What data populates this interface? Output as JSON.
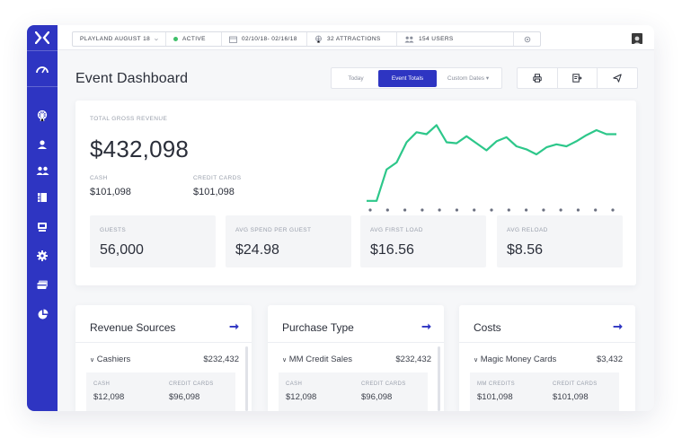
{
  "topbar": {
    "event": "PLAYLAND AUGUST 18",
    "status": "ACTIVE",
    "dates": "02/10/18- 02/16/18",
    "attractions": "32 ATTRACTIONS",
    "users": "154 USERS"
  },
  "colors": {
    "brand": "#2e35c2",
    "chart_line": "#2dc78a",
    "status_active": "#3fbf6a"
  },
  "page": {
    "title": "Event Dashboard",
    "tabs": [
      "Today",
      "Event Totals",
      "Custom Dates ▾"
    ],
    "active_tab": "Event Totals"
  },
  "summary": {
    "gross_label": "TOTAL GROSS REVENUE",
    "gross_value": "$432,098",
    "cash_label": "CASH",
    "cash_value": "$101,098",
    "credit_label": "CREDIT CARDS",
    "credit_value": "$101,098",
    "stats": [
      {
        "label": "GUESTS",
        "value": "56,000"
      },
      {
        "label": "AVG SPEND PER GUEST",
        "value": "$24.98"
      },
      {
        "label": "AVG FIRST LOAD",
        "value": "$16.56"
      },
      {
        "label": "AVG RELOAD",
        "value": "$8.56"
      }
    ]
  },
  "chart_data": {
    "type": "line",
    "title": "",
    "xlabel": "",
    "ylabel": "",
    "x": [
      1,
      2,
      3,
      4,
      5,
      6,
      7,
      8,
      9,
      10,
      11,
      12,
      13,
      14,
      15,
      16,
      17,
      18,
      19,
      20,
      21,
      22,
      23,
      24
    ],
    "series": [
      {
        "values": [
          2,
          2,
          33,
          40,
          60,
          70,
          68,
          77,
          60,
          59,
          66,
          59,
          52,
          61,
          65,
          56,
          53,
          48,
          55,
          58,
          56,
          61,
          67,
          72,
          68,
          68
        ]
      }
    ],
    "ylim": [
      0,
      80
    ],
    "grid": false,
    "dots_on_baseline": 15
  },
  "cards": [
    {
      "title": "Revenue Sources",
      "row_name": "Cashiers",
      "row_value": "$232,432",
      "sub1_label": "CASH",
      "sub1_value": "$12,098",
      "sub2_label": "CREDIT CARDS",
      "sub2_value": "$96,098"
    },
    {
      "title": "Purchase Type",
      "row_name": "MM Credit Sales",
      "row_value": "$232,432",
      "sub1_label": "CASH",
      "sub1_value": "$12,098",
      "sub2_label": "CREDIT CARDS",
      "sub2_value": "$96,098"
    },
    {
      "title": "Costs",
      "row_name": "Magic Money Cards",
      "row_value": "$3,432",
      "sub1_label": "MM CREDITS",
      "sub1_value": "$101,098",
      "sub2_label": "CREDIT CARDS",
      "sub2_value": "$101,098"
    }
  ],
  "icons": {
    "sidebar": [
      "logo-icon",
      "speedometer-icon",
      "ferris-wheel-icon",
      "user-icon",
      "users-icon",
      "ticket-icon",
      "kiosk-icon",
      "settings-icon",
      "card-icon",
      "pie-chart-icon"
    ],
    "actions": [
      "print-icon",
      "export-icon",
      "send-icon"
    ]
  }
}
